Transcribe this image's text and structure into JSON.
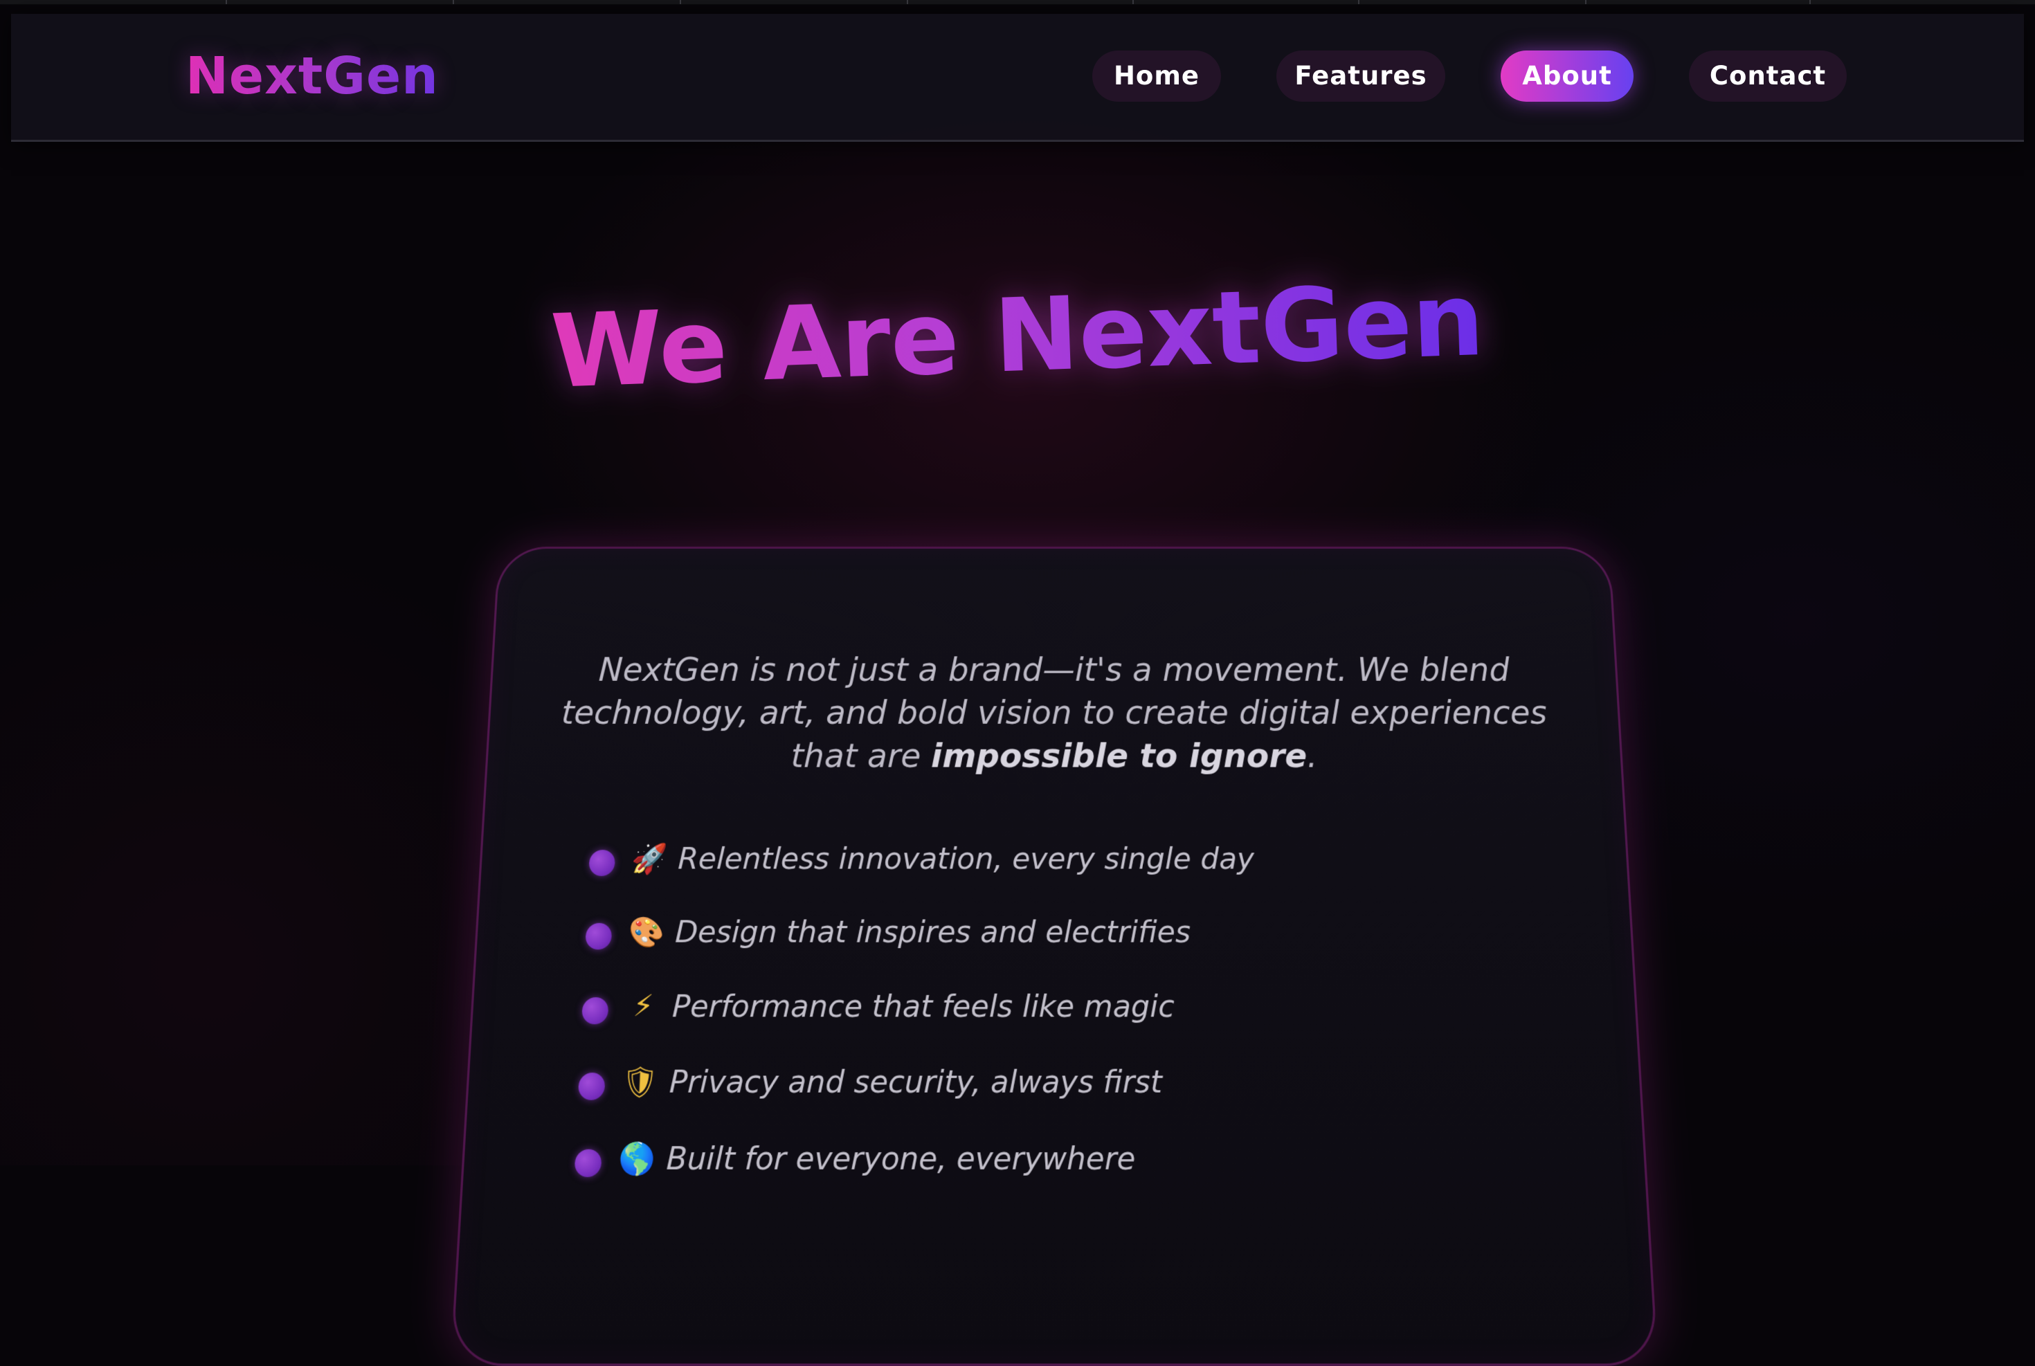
{
  "brand": {
    "logo_text": "NextGen",
    "accent_pink": "#e62fb3",
    "accent_violet": "#6a35e6"
  },
  "nav": {
    "items": [
      {
        "label": "Home",
        "active": false
      },
      {
        "label": "Features",
        "active": false
      },
      {
        "label": "About",
        "active": true
      },
      {
        "label": "Contact",
        "active": false
      }
    ]
  },
  "hero": {
    "title": "We Are NextGen"
  },
  "about": {
    "intro_text": "NextGen is not just a brand—it's a movement. We blend technology, art, and bold vision to create digital experiences that are ",
    "intro_emphasis": "impossible to ignore",
    "intro_end": ".",
    "features": [
      {
        "icon": "rocket-icon",
        "glyph": "🚀",
        "text": "Relentless innovation, every single day"
      },
      {
        "icon": "palette-icon",
        "glyph": "🎨",
        "text": "Design that inspires and electrifies"
      },
      {
        "icon": "lightning-icon",
        "glyph": "⚡",
        "text": "Performance that feels like magic"
      },
      {
        "icon": "shield-icon",
        "glyph": "🛡",
        "text": "Privacy and security, always first"
      },
      {
        "icon": "globe-icon",
        "glyph": "🌎",
        "text": "Built for everyone, everywhere"
      }
    ]
  }
}
